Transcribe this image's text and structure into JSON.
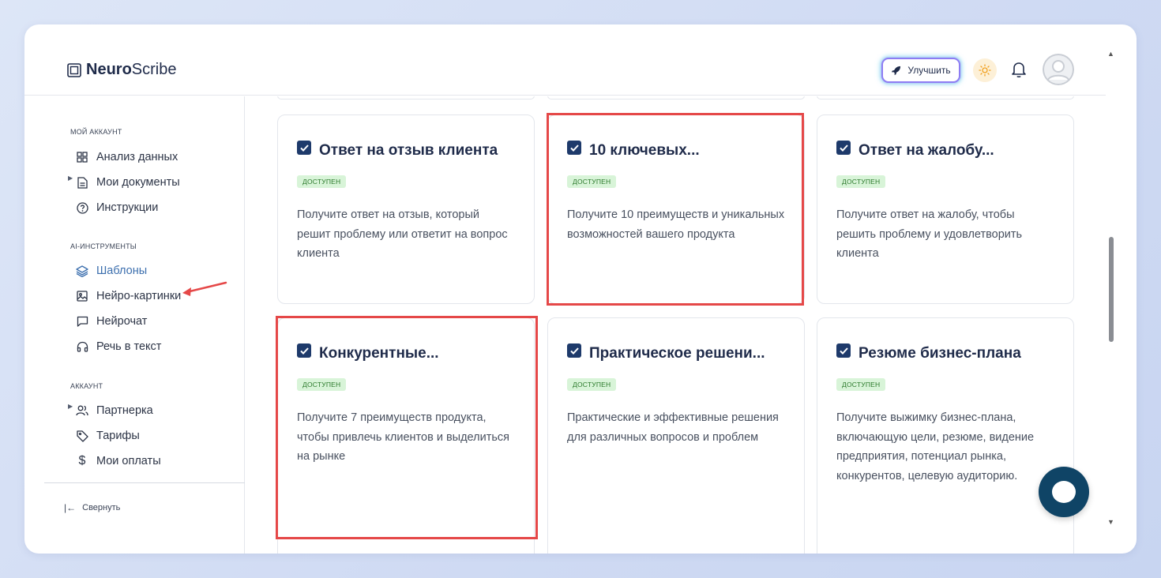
{
  "app": {
    "logo_bold": "Neuro",
    "logo_regular": "Scribe",
    "upgrade_label": "Улучшить"
  },
  "sidebar": {
    "sections": [
      {
        "title": "Мой аккаунт"
      },
      {
        "title": "AI-инструменты"
      },
      {
        "title": "Аккаунт"
      }
    ],
    "items": [
      {
        "label": "Анализ данных",
        "icon": "grid-icon"
      },
      {
        "label": "Мои документы",
        "icon": "document-icon"
      },
      {
        "label": "Инструкции",
        "icon": "question-icon"
      },
      {
        "label": "Шаблоны",
        "icon": "layers-icon",
        "active": true
      },
      {
        "label": "Нейро-картинки",
        "icon": "image-icon"
      },
      {
        "label": "Нейрочат",
        "icon": "chat-icon"
      },
      {
        "label": "Речь в текст",
        "icon": "headphones-icon"
      },
      {
        "label": "Партнерка",
        "icon": "users-icon"
      },
      {
        "label": "Тарифы",
        "icon": "tag-icon"
      },
      {
        "label": "Мои оплаты",
        "icon": "dollar-icon"
      }
    ],
    "collapse_label": "Свернуть"
  },
  "cards": [
    {
      "title": "Ответ на отзыв клиента",
      "badge": "доступен",
      "desc": "Получите ответ на отзыв, который решит проблему или ответит на вопрос клиента"
    },
    {
      "title": "10 ключевых...",
      "badge": "доступен",
      "desc": "Получите 10 преимуществ и уникальных возможностей вашего продукта"
    },
    {
      "title": "Ответ на жалобу...",
      "badge": "доступен",
      "desc": "Получите ответ на жалобу, чтобы решить проблему и удовлетворить клиента"
    },
    {
      "title": "Конкурентные...",
      "badge": "доступен",
      "desc": "Получите 7 преимуществ продукта, чтобы привлечь клиентов и выделиться на рынке"
    },
    {
      "title": "Практическое решени...",
      "badge": "доступен",
      "desc": "Практические и эффективные решения для различных вопросов и проблем"
    },
    {
      "title": "Резюме бизнес-плана",
      "badge": "доступен",
      "desc": "Получите выжимку бизнес-плана, включающую цели, резюме, видение предприятия, потенциал рынка, конкурентов, целевую аудиторию."
    }
  ],
  "colors": {
    "accent": "#3c6fae",
    "highlight": "#e54848",
    "badge_bg": "#d8f4d8",
    "badge_text": "#2c7a2c",
    "check": "#1e3a6b",
    "fab": "#0f4466"
  }
}
